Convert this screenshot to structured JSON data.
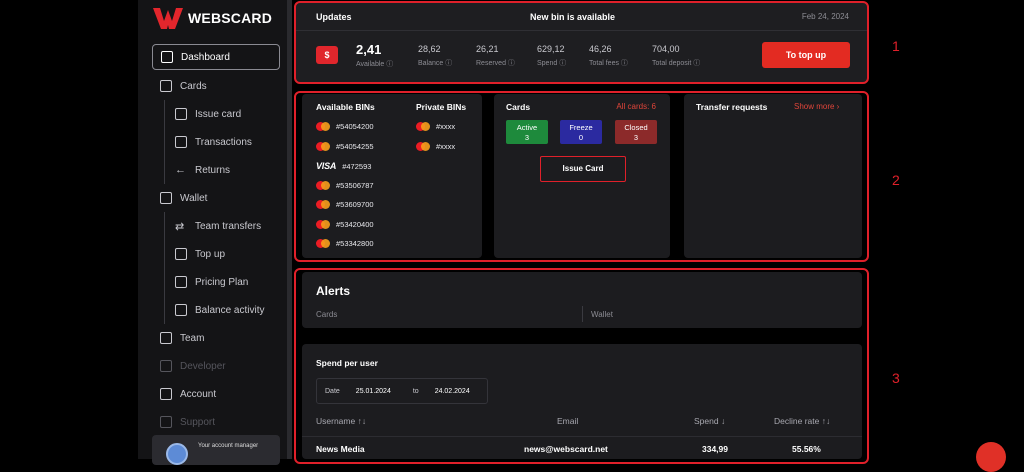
{
  "app": {
    "name": "WEBSCARD"
  },
  "sidebar": {
    "items": [
      {
        "label": "Dashboard"
      },
      {
        "label": "Cards"
      },
      {
        "label": "Issue card"
      },
      {
        "label": "Transactions"
      },
      {
        "label": "Returns"
      },
      {
        "label": "Wallet"
      },
      {
        "label": "Team transfers"
      },
      {
        "label": "Top up"
      },
      {
        "label": "Pricing Plan"
      },
      {
        "label": "Balance activity"
      },
      {
        "label": "Team"
      },
      {
        "label": "Developer"
      },
      {
        "label": "Account"
      },
      {
        "label": "Support"
      }
    ],
    "manager_label": "Your account manager"
  },
  "updates": {
    "title": "Updates",
    "announcement": "New bin is available",
    "date": "Feb 24, 2024",
    "card_icon": "$",
    "stats": [
      {
        "value": "2,41",
        "label": "Available"
      },
      {
        "value": "28,62",
        "label": "Balance"
      },
      {
        "value": "26,21",
        "label": "Reserved"
      },
      {
        "value": "629,12",
        "label": "Spend"
      },
      {
        "value": "46,26",
        "label": "Total fees"
      },
      {
        "value": "704,00",
        "label": "Total deposit"
      }
    ],
    "topup_label": "To top up"
  },
  "bins": {
    "available_title": "Available BINs",
    "private_title": "Private BINs",
    "available": [
      {
        "brand": "mastercard",
        "bin": "#54054200"
      },
      {
        "brand": "mastercard",
        "bin": "#54054255"
      },
      {
        "brand": "visa",
        "bin": "#472593"
      },
      {
        "brand": "mastercard",
        "bin": "#53506787"
      },
      {
        "brand": "mastercard",
        "bin": "#53609700"
      },
      {
        "brand": "mastercard",
        "bin": "#53420400"
      },
      {
        "brand": "mastercard",
        "bin": "#53342800"
      }
    ],
    "private": [
      {
        "brand": "mastercard",
        "bin": "#xxxx"
      },
      {
        "brand": "mastercard",
        "bin": "#xxxx"
      }
    ],
    "visa_label": "VISA"
  },
  "cards": {
    "title": "Cards",
    "all_cards": "All cards: 6",
    "statuses": [
      {
        "label": "Active",
        "count": "3",
        "color": "#1e8a3c"
      },
      {
        "label": "Freeze",
        "count": "0",
        "color": "#2b2aa0"
      },
      {
        "label": "Closed",
        "count": "3",
        "color": "#8c2a2a"
      }
    ],
    "issue_label": "Issue Card"
  },
  "transfer": {
    "title": "Transfer requests",
    "show_more": "Show more ›"
  },
  "alerts": {
    "title": "Alerts",
    "col_cards": "Cards",
    "col_wallet": "Wallet"
  },
  "spend": {
    "title": "Spend per user",
    "date_label": "Date",
    "date_from": "25.01.2024",
    "date_to_label": "to",
    "date_to": "24.02.2024",
    "headers": {
      "username": "Username ↑↓",
      "email": "Email",
      "spend": "Spend ↓",
      "decline": "Decline rate ↑↓"
    },
    "rows": [
      {
        "username": "News Media",
        "email": "news@webscard.net",
        "spend": "334,99",
        "decline": "55.56%"
      }
    ]
  },
  "annotations": {
    "one": "1",
    "two": "2",
    "three": "3"
  },
  "colors": {
    "accent": "#e32b22",
    "annotation": "#e0202a",
    "panel": "#1c1c1f"
  }
}
